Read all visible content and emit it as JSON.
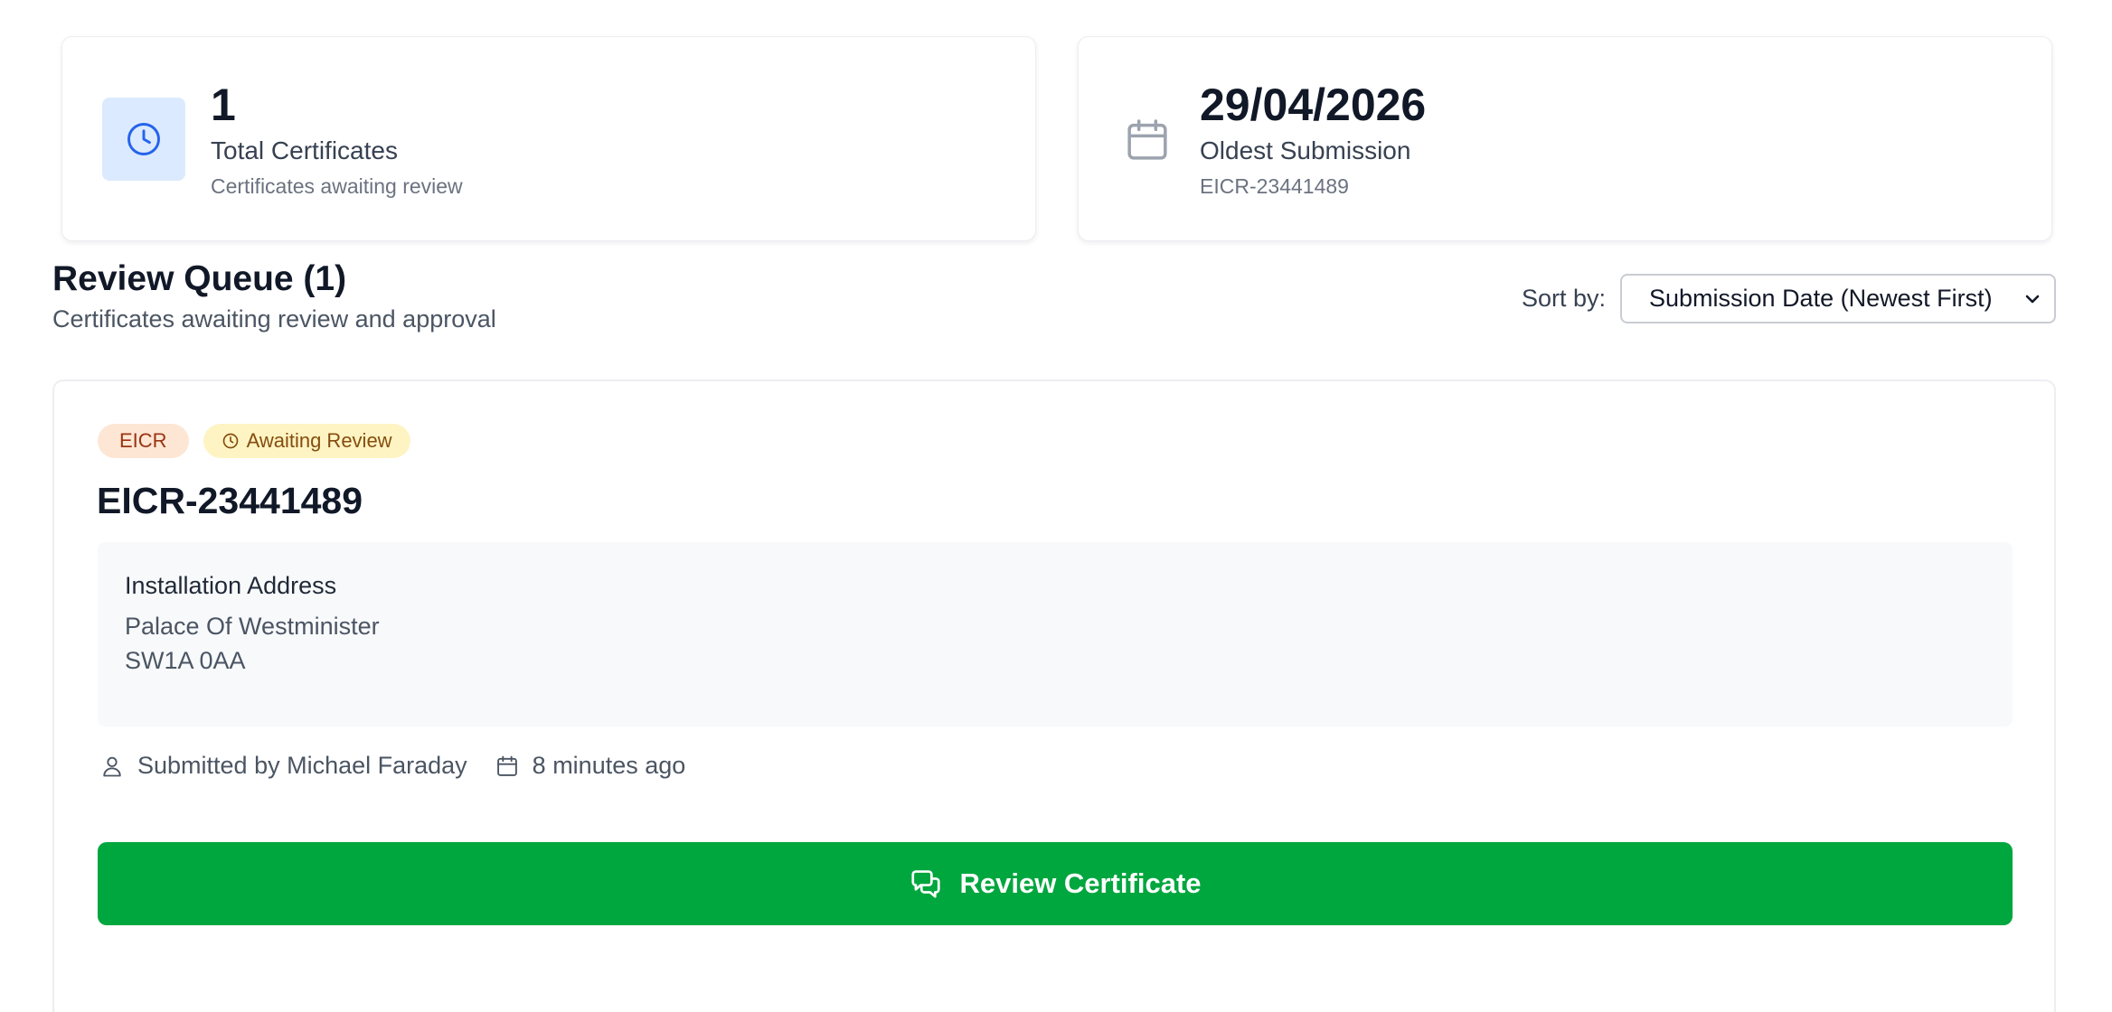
{
  "stats": {
    "total": {
      "value": "1",
      "label": "Total Certificates",
      "sub": "Certificates awaiting review",
      "icon": "clock-icon"
    },
    "oldest": {
      "value": "29/04/2026",
      "label": "Oldest Submission",
      "sub": "EICR-23441489",
      "icon": "calendar-icon"
    }
  },
  "queue": {
    "title": "Review Queue (1)",
    "subtitle": "Certificates awaiting review and approval",
    "sort_label": "Sort by:",
    "sort_value": "Submission Date (Newest First)"
  },
  "certificate": {
    "type_badge": "EICR",
    "status_badge": "Awaiting Review",
    "id": "EICR-23441489",
    "address_title": "Installation Address",
    "address_line1": "Palace Of Westminister",
    "address_line2": "SW1A 0AA",
    "submitted_by": "Submitted by Michael Faraday",
    "submitted_time": "8 minutes ago",
    "review_button": "Review Certificate"
  },
  "colors": {
    "accent_blue": "#2563eb",
    "button_green": "#00a63e",
    "type_badge_bg": "#fde6d4",
    "status_badge_bg": "#fef4c3"
  }
}
